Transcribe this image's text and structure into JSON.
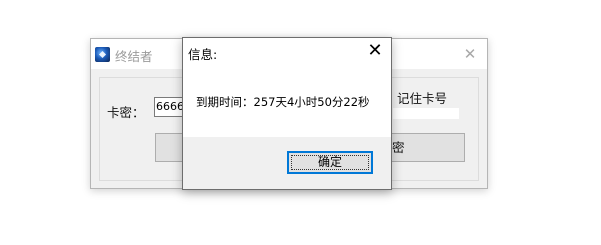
{
  "background_window": {
    "title": "终结者",
    "close_glyph": "✕",
    "card_label": "卡密：",
    "card_value": "66666",
    "remember_label": "记住卡号",
    "button_partial_text": "密"
  },
  "dialog": {
    "title": "信息:",
    "close_glyph": "✕",
    "message": "到期时间：257天4小时50分22秒",
    "ok_label": "确定"
  },
  "colors": {
    "focus_border": "#0078d7",
    "dialog_footer": "#f0f0f0",
    "button_face": "#e1e1e1"
  }
}
